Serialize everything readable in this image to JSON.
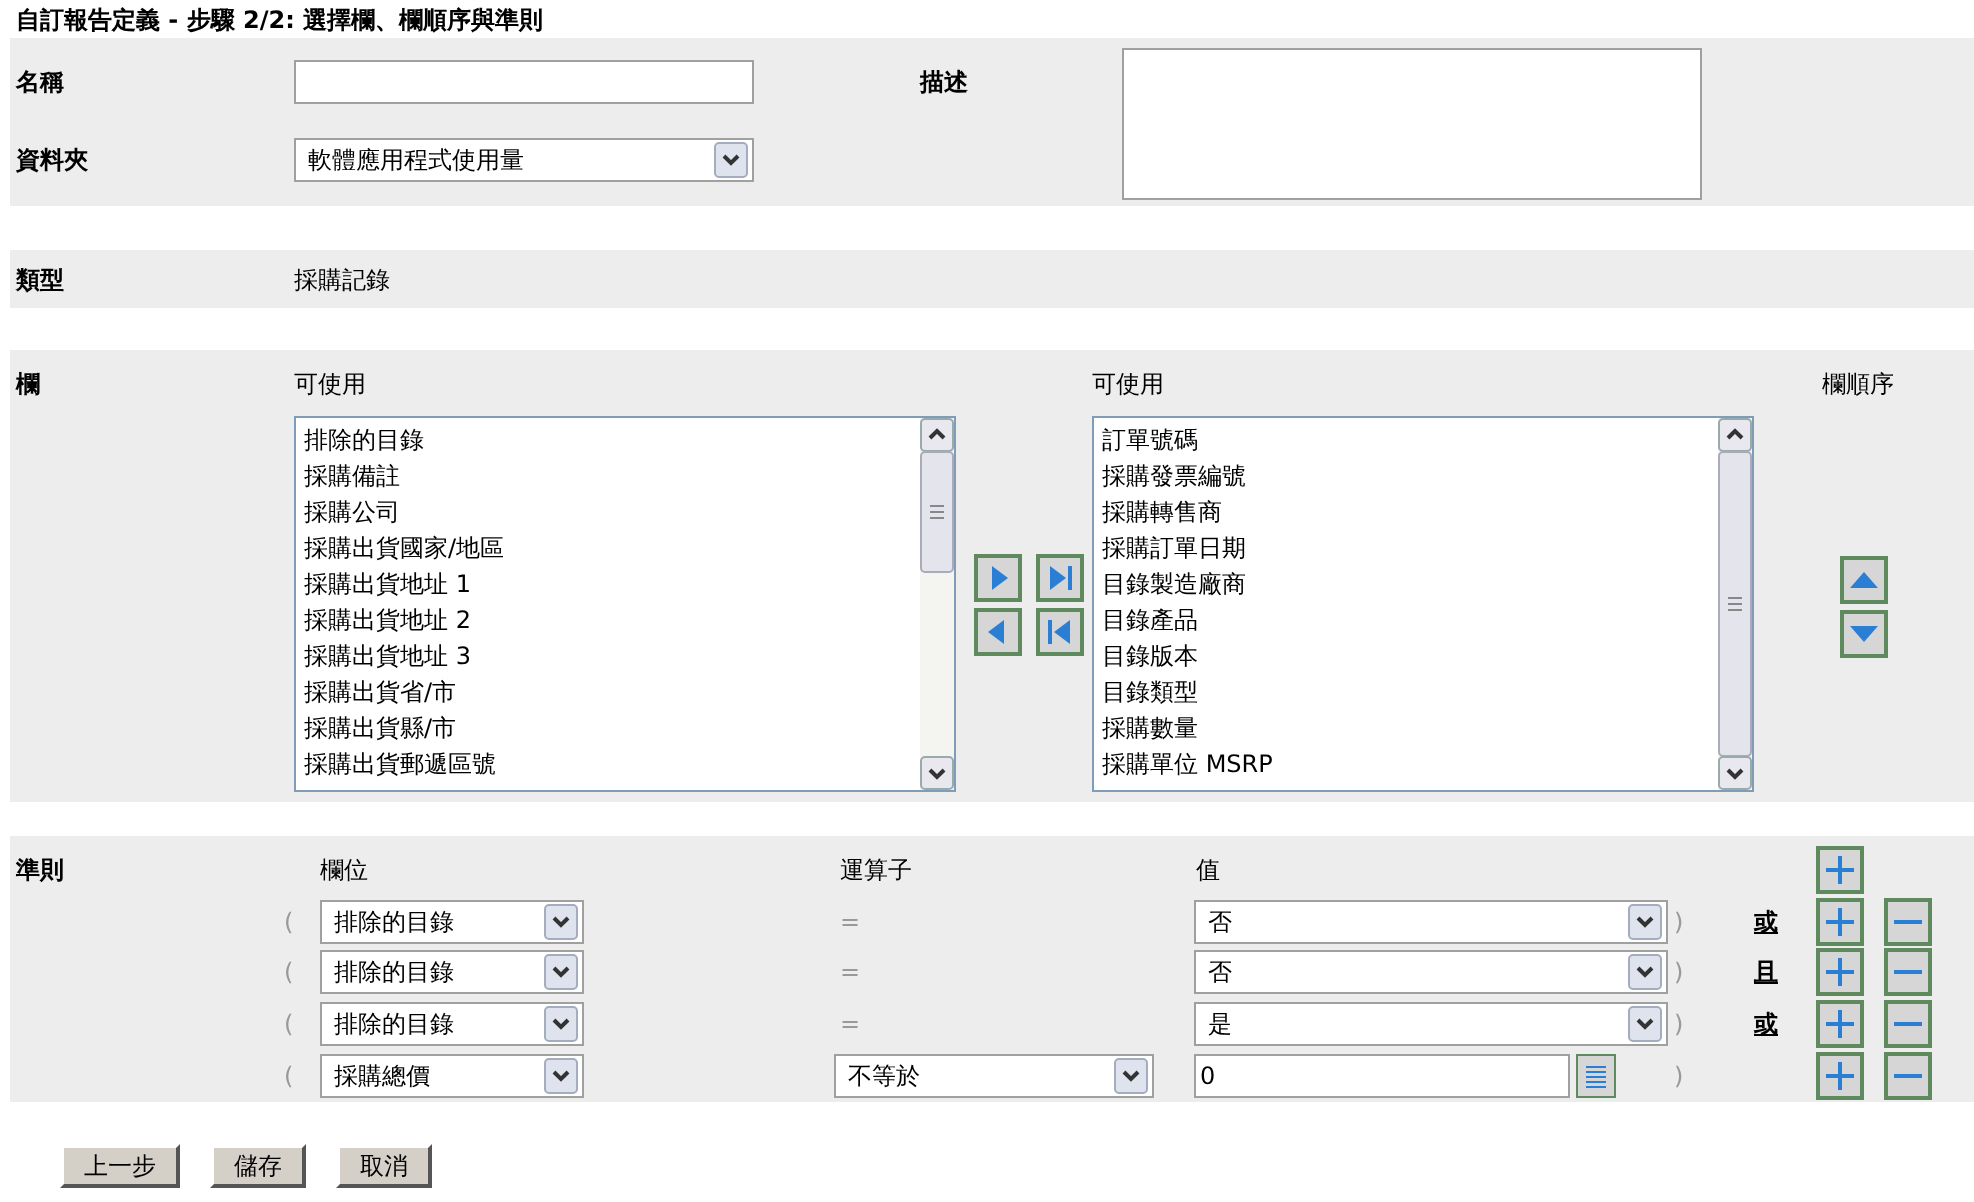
{
  "title": "自訂報告定義 - 步驟 2/2: 選擇欄、欄順序與準則",
  "name": {
    "label": "名稱"
  },
  "description": {
    "label": "描述"
  },
  "folder": {
    "label": "資料夾",
    "value": "軟體應用程式使用量"
  },
  "type": {
    "label": "類型",
    "value": "採購記錄"
  },
  "columns": {
    "label": "欄",
    "available": {
      "heading": "可使用",
      "items": [
        "排除的目錄",
        "採購備註",
        "採購公司",
        "採購出貨國家/地區",
        "採購出貨地址 1",
        "採購出貨地址 2",
        "採購出貨地址 3",
        "採購出貨省/市",
        "採購出貨縣/市",
        "採購出貨郵遞區號"
      ]
    },
    "selected": {
      "heading": "可使用",
      "items": [
        "訂單號碼",
        "採購發票編號",
        "採購轉售商",
        "採購訂單日期",
        "目錄製造廠商",
        "目錄產品",
        "目錄版本",
        "目錄類型",
        "採購數量",
        "採購單位 MSRP"
      ]
    },
    "order_heading": "欄順序"
  },
  "criteria": {
    "label": "準則",
    "headings": [
      "欄位",
      "運算子",
      "值"
    ],
    "rows": [
      {
        "open": "(",
        "field": "排除的目錄",
        "operator": {
          "kind": "text",
          "value": "="
        },
        "value": {
          "kind": "select",
          "value": "否"
        },
        "close": ")",
        "connector": "或"
      },
      {
        "open": "(",
        "field": "排除的目錄",
        "operator": {
          "kind": "text",
          "value": "="
        },
        "value": {
          "kind": "select",
          "value": "否"
        },
        "close": ")",
        "connector": "且"
      },
      {
        "open": "(",
        "field": "排除的目錄",
        "operator": {
          "kind": "text",
          "value": "="
        },
        "value": {
          "kind": "select",
          "value": "是"
        },
        "close": ")",
        "connector": "或"
      },
      {
        "open": "(",
        "field": "採購總價",
        "operator": {
          "kind": "select",
          "value": "不等於"
        },
        "value": {
          "kind": "input",
          "value": "0"
        },
        "close": ")"
      }
    ]
  },
  "buttons": [
    "上一步",
    "儲存",
    "取消"
  ]
}
